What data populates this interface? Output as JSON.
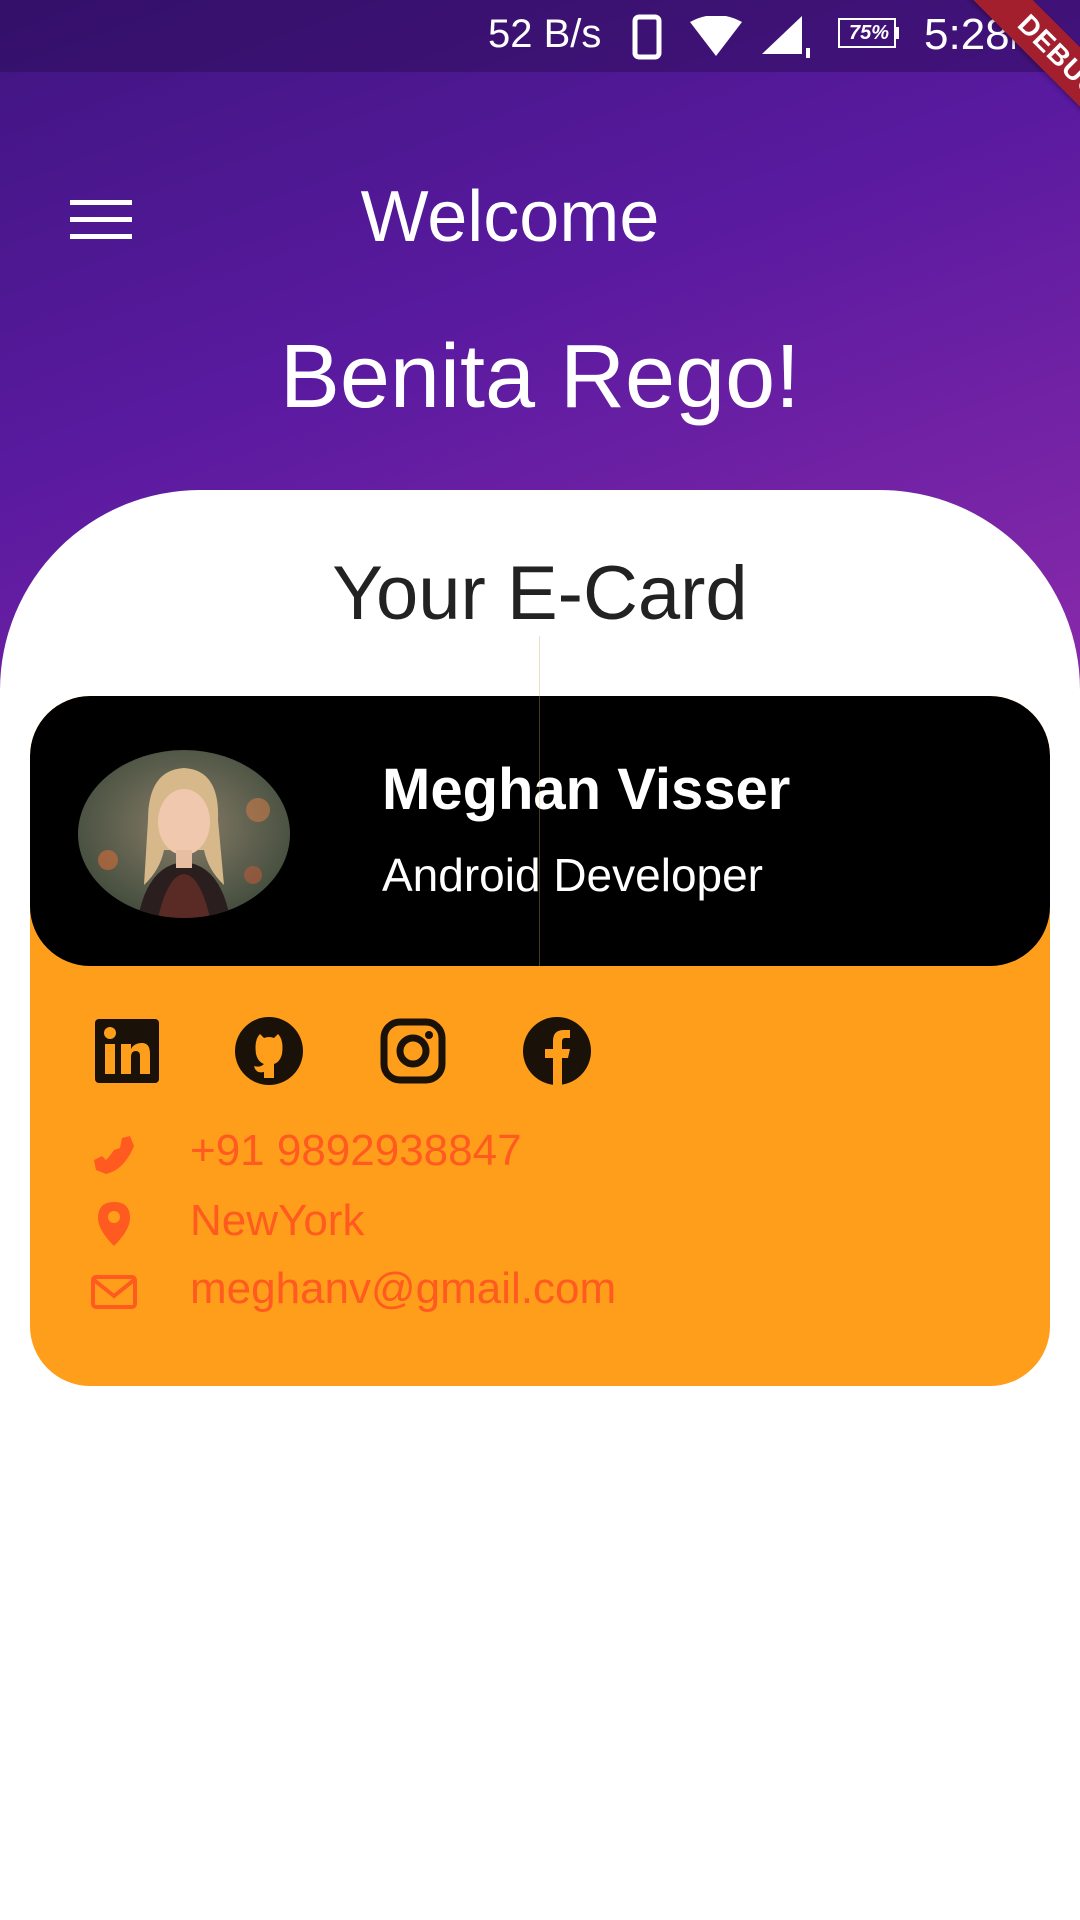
{
  "status_bar": {
    "net_speed": "52 B/s",
    "battery": "75%",
    "time": "5:28",
    "ampm": "PM"
  },
  "debug_banner": "DEBUG",
  "header": {
    "title": "Welcome",
    "greeting": "Benita Rego!"
  },
  "ecard": {
    "heading": "Your E-Card",
    "name": "Meghan Visser",
    "role": "Android Developer",
    "social": [
      "linkedin-icon",
      "github-icon",
      "instagram-icon",
      "facebook-icon"
    ],
    "phone": "+91 9892938847",
    "location": "NewYork",
    "email": "meghanv@gmail.com"
  },
  "colors": {
    "header_gradient_start": "#3f1580",
    "header_gradient_end": "#8a2aaa",
    "card_orange": "#ff9e1a",
    "contact_text": "#ff5a1f",
    "card_top": "#000000"
  }
}
